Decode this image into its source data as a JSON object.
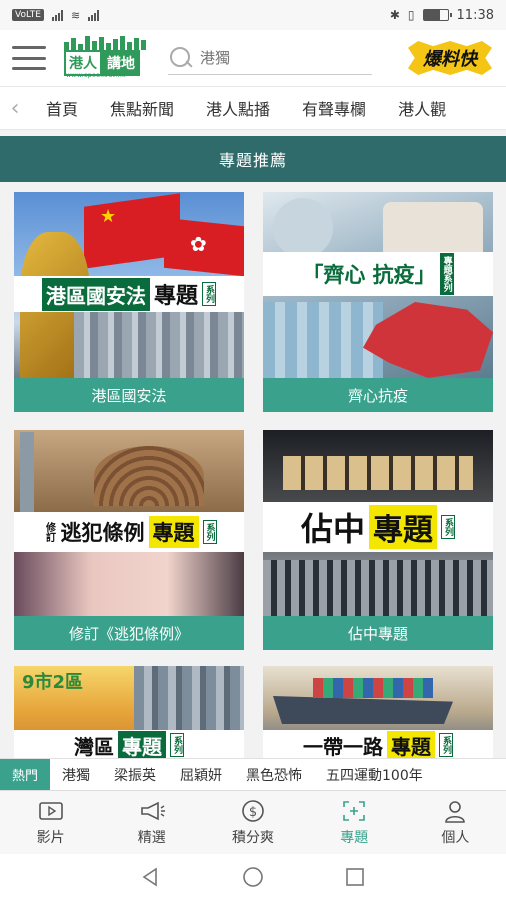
{
  "status_bar": {
    "carrier_chip": "VoLTE",
    "time": "11:38",
    "battery_level": 0.7
  },
  "header": {
    "logo_left": "港人",
    "logo_right": "講地",
    "logo_url": "www.speakout.hk",
    "search_placeholder": "港獨",
    "badge_text": "爆料快"
  },
  "nav_tabs": [
    "首頁",
    "焦點新聞",
    "港人點播",
    "有聲專欄",
    "港人觀"
  ],
  "section_title": "專題推薦",
  "cards": [
    {
      "caption": "港區國安法",
      "banner": "港區國安法",
      "banner_suffix": "專題",
      "tag": "系列"
    },
    {
      "caption": "齊心抗疫",
      "banner": "「齊心 抗疫」",
      "tag": "專題系列"
    },
    {
      "caption": "修訂《逃犯條例》",
      "banner": "逃犯條例",
      "banner_prefix": "修訂",
      "banner_suffix": "專題",
      "tag": "系列"
    },
    {
      "caption": "佔中專題",
      "banner": "佔中",
      "banner_suffix": "專題",
      "tag": "系列"
    },
    {
      "caption": "",
      "banner": "灣區",
      "banner_suffix": "專題",
      "tag": "系列",
      "overlay": "9市2區"
    },
    {
      "caption": "",
      "banner": "一帶一路",
      "banner_suffix": "專題",
      "tag": "系列"
    }
  ],
  "hot_tags": {
    "label": "熱門",
    "items": [
      "港獨",
      "梁振英",
      "屈穎妍",
      "黑色恐怖",
      "五四運動100年"
    ]
  },
  "bottom_nav": [
    {
      "label": "影片",
      "icon": "video-icon",
      "active": false
    },
    {
      "label": "精選",
      "icon": "megaphone-icon",
      "active": false
    },
    {
      "label": "積分爽",
      "icon": "dollar-coin-icon",
      "active": false
    },
    {
      "label": "專題",
      "icon": "topic-frame-icon",
      "active": true
    },
    {
      "label": "個人",
      "icon": "person-icon",
      "active": false
    }
  ],
  "colors": {
    "brand_green": "#2f9a5a",
    "section_bar": "#2f6b6b",
    "caption_teal": "#3aa28c",
    "badge_yellow": "#f5c515"
  }
}
